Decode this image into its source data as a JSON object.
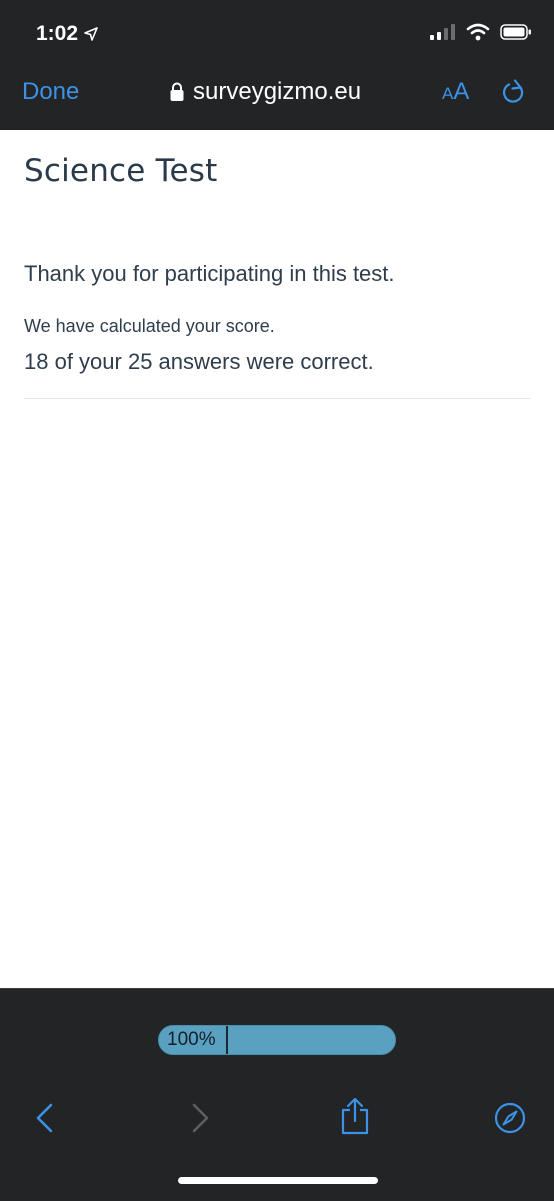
{
  "status_bar": {
    "time": "1:02",
    "icons": [
      "location-arrow-icon",
      "signal-icon",
      "wifi-icon",
      "battery-icon"
    ]
  },
  "browser": {
    "done_label": "Done",
    "url": "surveygizmo.eu",
    "text_size_label_small": "A",
    "text_size_label_large": "A",
    "accent_color": "#3c92e6"
  },
  "page": {
    "title": "Science Test",
    "thank_you": "Thank you for participating in this test.",
    "calculated": "We have calculated your score.",
    "score_line": "18 of your 25 answers were correct."
  },
  "progress": {
    "label": "100%",
    "value": 1.0
  },
  "toolbar": {
    "icons": [
      "back-icon",
      "forward-icon",
      "share-icon",
      "compass-icon"
    ]
  }
}
